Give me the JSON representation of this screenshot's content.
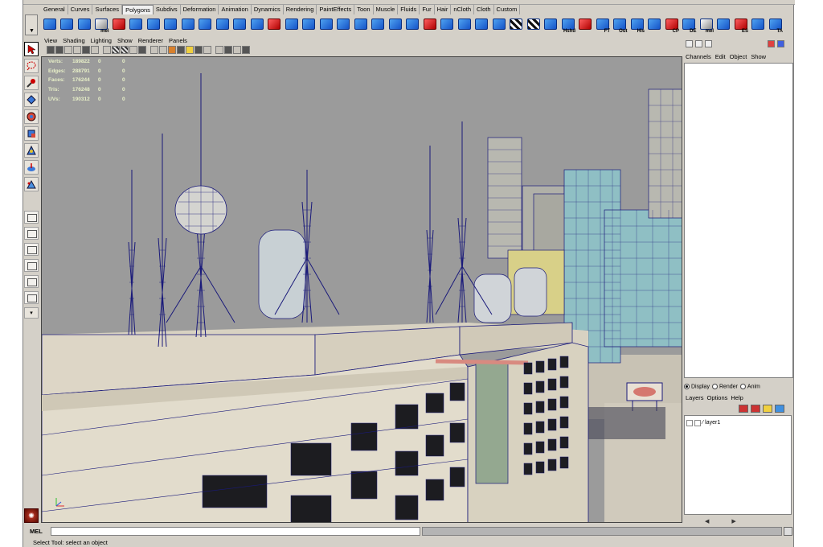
{
  "shelf": {
    "tabs": [
      "General",
      "Curves",
      "Surfaces",
      "Polygons",
      "Subdivs",
      "Deformation",
      "Animation",
      "Dynamics",
      "Rendering",
      "PaintEffects",
      "Toon",
      "Muscle",
      "Fluids",
      "Fur",
      "Hair",
      "nCloth",
      "Cloth",
      "Custom"
    ],
    "active_tab": "Polygons",
    "icons": [
      {
        "name": "poly-sphere-icon",
        "label": ""
      },
      {
        "name": "poly-cube-icon",
        "label": ""
      },
      {
        "name": "poly-cylinder-icon",
        "label": ""
      },
      {
        "name": "mel-script-icon",
        "label": "mel"
      },
      {
        "name": "poly-cone-icon",
        "label": ""
      },
      {
        "name": "poly-plane-icon",
        "label": ""
      },
      {
        "name": "poly-torus-icon",
        "label": ""
      },
      {
        "name": "combine-icon",
        "label": ""
      },
      {
        "name": "separate-icon",
        "label": ""
      },
      {
        "name": "extract-icon",
        "label": ""
      },
      {
        "name": "smooth-icon",
        "label": ""
      },
      {
        "name": "boolean-union-icon",
        "label": ""
      },
      {
        "name": "boolean-difference-icon",
        "label": ""
      },
      {
        "name": "boolean-intersect-icon",
        "label": ""
      },
      {
        "name": "mirror-icon",
        "label": ""
      },
      {
        "name": "bridge-icon",
        "label": ""
      },
      {
        "name": "extrude-icon",
        "label": ""
      },
      {
        "name": "bevel-icon",
        "label": ""
      },
      {
        "name": "append-icon",
        "label": ""
      },
      {
        "name": "split-polygon-icon",
        "label": ""
      },
      {
        "name": "insert-edge-loop-icon",
        "label": ""
      },
      {
        "name": "wedge-icon",
        "label": ""
      },
      {
        "name": "merge-icon",
        "label": ""
      },
      {
        "name": "collapse-icon",
        "label": ""
      },
      {
        "name": "delete-edge-icon",
        "label": ""
      },
      {
        "name": "planar-mapping-icon",
        "label": ""
      },
      {
        "name": "cylindrical-mapping-icon",
        "label": ""
      },
      {
        "name": "spherical-mapping-icon",
        "label": ""
      },
      {
        "name": "automatic-mapping-icon",
        "label": ""
      },
      {
        "name": "uv-texture-editor-icon",
        "label": ""
      },
      {
        "name": "hypershade-icon",
        "label": "Hshd"
      },
      {
        "name": "light-icon",
        "label": ""
      },
      {
        "name": "fill-triangle-icon",
        "label": "FT"
      },
      {
        "name": "outliner-icon",
        "label": "Out"
      },
      {
        "name": "hypergraph-icon",
        "label": "His"
      },
      {
        "name": "graph-editor-icon",
        "label": ""
      },
      {
        "name": "center-pivot-icon",
        "label": "CP"
      },
      {
        "name": "delete-history-icon",
        "label": "DE"
      },
      {
        "name": "mel-icon-2",
        "label": "mel"
      },
      {
        "name": "snap-icon",
        "label": ""
      },
      {
        "name": "edge-select-icon",
        "label": "ES"
      },
      {
        "name": "triangulate-icon",
        "label": ""
      },
      {
        "name": "texture-assign-icon",
        "label": "TA"
      }
    ]
  },
  "viewport": {
    "menu": [
      "View",
      "Shading",
      "Lighting",
      "Show",
      "Renderer",
      "Panels"
    ],
    "hud": [
      {
        "label": "Verts:",
        "value": "189822",
        "a": "0",
        "b": "0"
      },
      {
        "label": "Edges:",
        "value": "288791",
        "a": "0",
        "b": "0"
      },
      {
        "label": "Faces:",
        "value": "176244",
        "a": "0",
        "b": "0"
      },
      {
        "label": "Tris:",
        "value": "176248",
        "a": "0",
        "b": "0"
      },
      {
        "label": "UVs:",
        "value": "190312",
        "a": "0",
        "b": "0"
      }
    ]
  },
  "channel_box": {
    "menu": [
      "Channels",
      "Edit",
      "Object",
      "Show"
    ]
  },
  "layer_editor": {
    "modes": [
      {
        "label": "Display",
        "selected": true
      },
      {
        "label": "Render",
        "selected": false
      },
      {
        "label": "Anim",
        "selected": false
      }
    ],
    "menu": [
      "Layers",
      "Options",
      "Help"
    ],
    "layers": [
      {
        "name": "layer1"
      }
    ]
  },
  "command_line": {
    "label": "MEL",
    "value": ""
  },
  "help_line": "Select Tool: select an object",
  "colors": {
    "ui_gray": "#d4d0c8",
    "viewport_bg": "#9b9b9b",
    "wireframe": "#1a1a7a",
    "shelf_icon": "#2a6fd8"
  }
}
